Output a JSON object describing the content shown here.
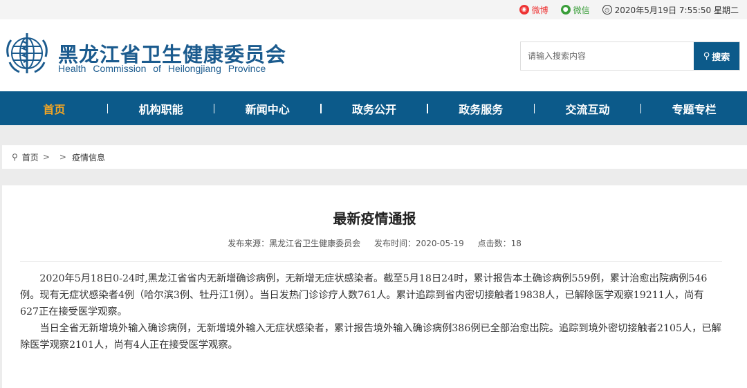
{
  "topbar": {
    "weibo_label": "微博",
    "wechat_label": "微信",
    "datetime": "2020年5月19日 7:55:50 星期二"
  },
  "header": {
    "title": "黑龙江省卫生健康委员会",
    "subtitle": "Health Commission of Heilongjiang Province"
  },
  "search": {
    "placeholder": "请输入搜索内容",
    "button_label": "搜索"
  },
  "nav": {
    "items": [
      {
        "label": "首页"
      },
      {
        "label": "机构职能"
      },
      {
        "label": "新闻中心"
      },
      {
        "label": "政务公开"
      },
      {
        "label": "政务服务"
      },
      {
        "label": "交流互动"
      },
      {
        "label": "专题专栏"
      }
    ]
  },
  "breadcrumb": {
    "home": "首页",
    "current": "疫情信息"
  },
  "article": {
    "title": "最新疫情通报",
    "source": "发布来源：黑龙江省卫生健康委员会",
    "time": "发布时间：2020-05-19",
    "clicks": "点击数：18",
    "paragraphs": [
      "2020年5月18日0-24时,黑龙江省省内无新增确诊病例，无新增无症状感染者。截至5月18日24时，累计报告本土确诊病例559例，累计治愈出院病例546例。现有无症状感染者4例（哈尔滨3例、牡丹江1例）。当日发热门诊诊疗人数761人。累计追踪到省内密切接触者19838人，已解除医学观察19211人，尚有627正在接受医学观察。",
      "当日全省无新增境外输入确诊病例，无新增境外输入无症状感染者，累计报告境外输入确诊病例386例已全部治愈出院。追踪到境外密切接触者2105人，已解除医学观察2101人，尚有4人正在接受医学观察。"
    ]
  }
}
